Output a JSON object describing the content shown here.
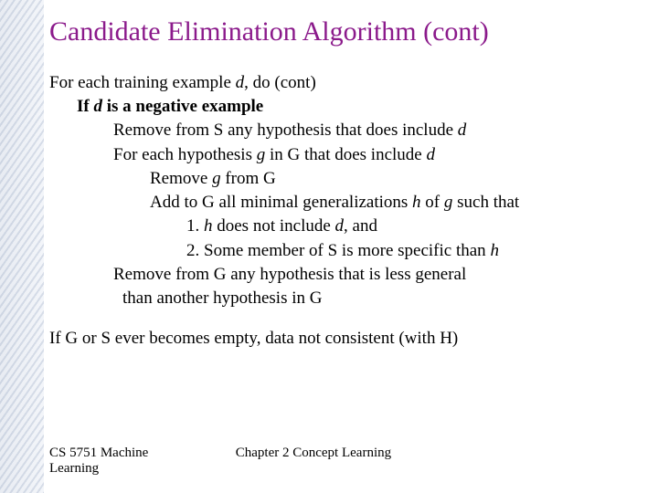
{
  "title": "Candidate Elimination Algorithm (cont)",
  "lines": {
    "l1a": "For each training example ",
    "l1b": "d",
    "l1c": ", do (cont)",
    "l2a": "If ",
    "l2b": "d",
    "l2c": " is a negative example",
    "l3a": "Remove from S any hypothesis that does include ",
    "l3b": "d",
    "l4a": "For each hypothesis ",
    "l4b": "g",
    "l4c": " in G that does include ",
    "l4d": "d",
    "l5a": "Remove ",
    "l5b": "g",
    "l5c": " from G",
    "l6a": "Add to G all minimal generalizations ",
    "l6b": "h",
    "l6c": " of ",
    "l6d": "g",
    "l6e": " such that",
    "l7a": "1. ",
    "l7b": "h",
    "l7c": " does not include ",
    "l7d": "d",
    "l7e": ", and",
    "l8a": "2. Some member of S is more specific than ",
    "l8b": "h",
    "l9": "Remove from G any hypothesis that is less general",
    "l10": "than another hypothesis in G",
    "l11": "If G or S ever becomes empty, data not consistent (with H)"
  },
  "footer": {
    "left1": "CS 5751 Machine",
    "left2": "Learning",
    "center": "Chapter 2  Concept Learning"
  }
}
